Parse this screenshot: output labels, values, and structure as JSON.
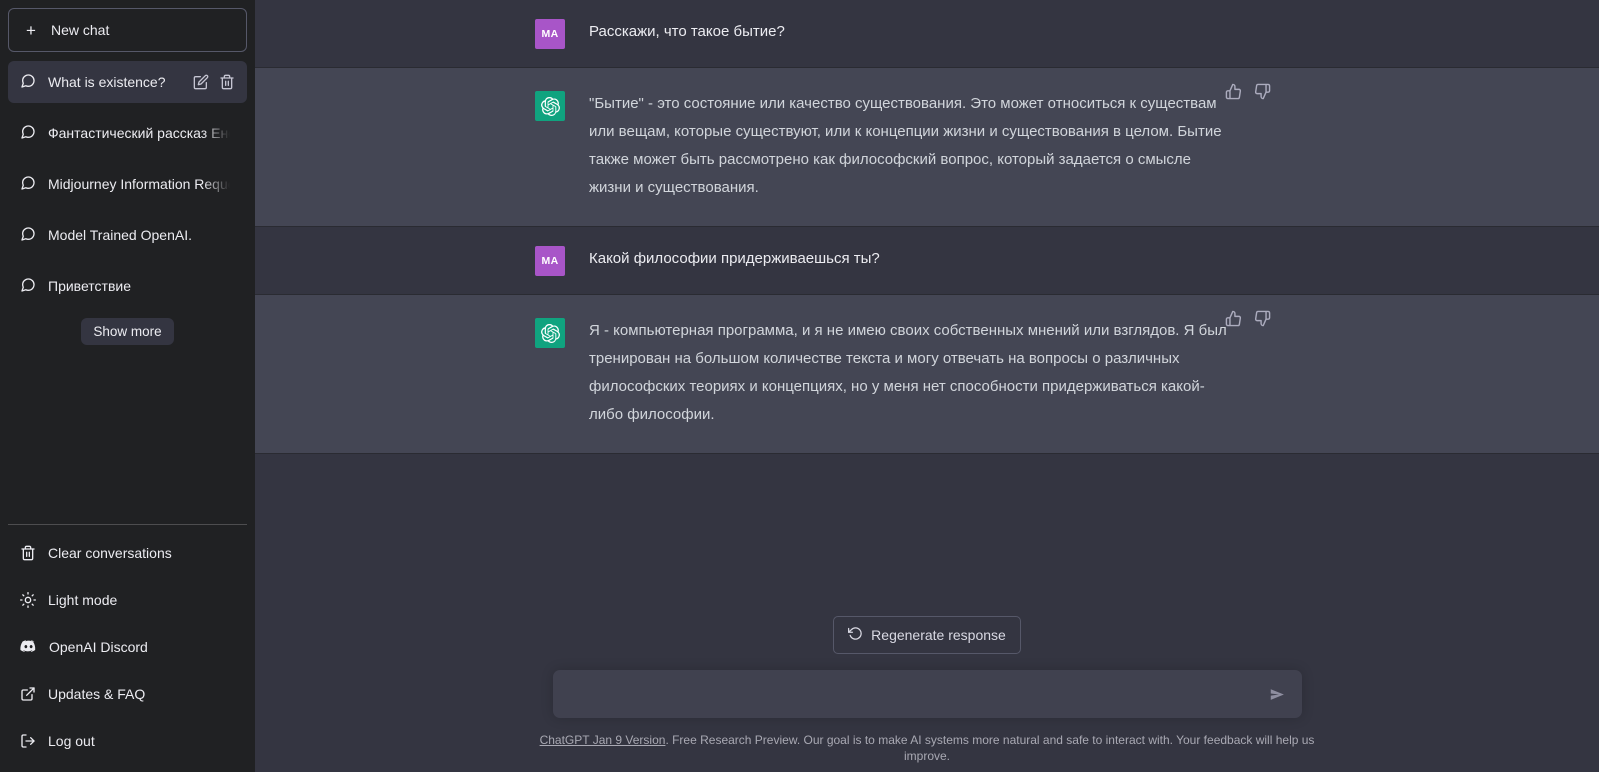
{
  "sidebar": {
    "new_chat_label": "New chat",
    "chats": [
      {
        "label": "What is existence?",
        "active": true
      },
      {
        "label": "Фантастический рассказ Енот",
        "active": false
      },
      {
        "label": "Midjourney Information Reque",
        "active": false
      },
      {
        "label": "Model Trained OpenAI.",
        "active": false
      },
      {
        "label": "Приветствие",
        "active": false
      }
    ],
    "show_more_label": "Show more",
    "menu": [
      {
        "label": "Clear conversations",
        "icon": "trash-icon"
      },
      {
        "label": "Light mode",
        "icon": "sun-icon"
      },
      {
        "label": "OpenAI Discord",
        "icon": "discord-icon"
      },
      {
        "label": "Updates & FAQ",
        "icon": "external-link-icon"
      },
      {
        "label": "Log out",
        "icon": "logout-icon"
      }
    ]
  },
  "conversation": {
    "user_initials": "MA",
    "messages": [
      {
        "role": "user",
        "text": "Расскажи, что такое бытие?"
      },
      {
        "role": "assistant",
        "text": "\"Бытие\" - это состояние или качество существования. Это может относиться к существам или вещам, которые существуют, или к концепции жизни и существования в целом. Бытие также может быть рассмотрено как философский вопрос, который задается о смысле жизни и существования."
      },
      {
        "role": "user",
        "text": "Какой философии придерживаешься ты?"
      },
      {
        "role": "assistant",
        "text": "Я - компьютерная программа, и я не имею своих собственных мнений или взглядов. Я был тренирован на большом количестве текста и могу отвечать на вопросы о различных философских теориях и концепциях, но у меня нет способности придерживаться какой-либо философии."
      }
    ]
  },
  "composer": {
    "regenerate_label": "Regenerate response",
    "input_value": "",
    "input_placeholder": ""
  },
  "footer": {
    "link_text": "ChatGPT Jan 9 Version",
    "rest_text": ". Free Research Preview. Our goal is to make AI systems more natural and safe to interact with. Your feedback will help us improve."
  },
  "colors": {
    "sidebar_bg": "#202123",
    "user_row_bg": "#343541",
    "assistant_row_bg": "#444654",
    "user_avatar": "#a855c8",
    "bot_avatar": "#10a37f"
  }
}
